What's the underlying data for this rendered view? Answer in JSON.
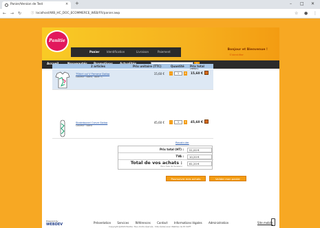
{
  "browser": {
    "tab_title": "Panier/Version de Test",
    "url": "localhost/WB_HC_DOC_ECOMMERCE_WEB/FR/panier.awp"
  },
  "site": {
    "logo_text": "Panitie",
    "greeting": "Bonjour et Bienvenue !",
    "connect_link": "S'identifier",
    "menu": [
      "Accueil",
      "Nouveautés",
      "Promotions",
      "Actualités"
    ],
    "search_placeholder": "Rechercher un produit..."
  },
  "steps": [
    "Panier",
    "Identification",
    "Livraison",
    "Paiement"
  ],
  "cart": {
    "headers": [
      "2 articles",
      "Prix unitaire (TTC)",
      "Quantité",
      "Prix total (TTC)"
    ],
    "items": [
      {
        "name": "TShirt col V Femme Dalba",
        "desc": "Couleur : Blanc, Taille : L",
        "unit": "15,60 €",
        "qty": "1",
        "total": "15,60 €"
      },
      {
        "name": "Skateboard Carve Dalba",
        "desc": "Couleur : Blanc",
        "unit": "45,60 €",
        "qty": "1",
        "total": "45,60 €"
      }
    ],
    "recalc": "Recalculer"
  },
  "totals": {
    "ht_label": "Prix total (HT) :",
    "ht_value": "51,00 €",
    "tva_label": "TVA :",
    "tva_value": "10,20 €",
    "all_label": "Total de vos achats :",
    "all_value": "61,20 €",
    "sub": "(hors frais de livraison)"
  },
  "buttons": {
    "continue": "Poursuivre mes achats",
    "validate": "Valider mon panier"
  },
  "footer": {
    "powered": "Powered by",
    "brand": "WEBDEV",
    "links": [
      "Présentation",
      "Services",
      "Références",
      "Contact",
      "Informations légales",
      "Administration"
    ],
    "copyright": "Copyright @2024 Panitie. Tous droits réservés - Site réalisé avec WebDev de PC SOFT",
    "mobile": "Site mobile"
  },
  "colors": {
    "accent": "#f39c12",
    "menu_bg": "#2b2b2b",
    "table_head": "#a8c6e6"
  }
}
